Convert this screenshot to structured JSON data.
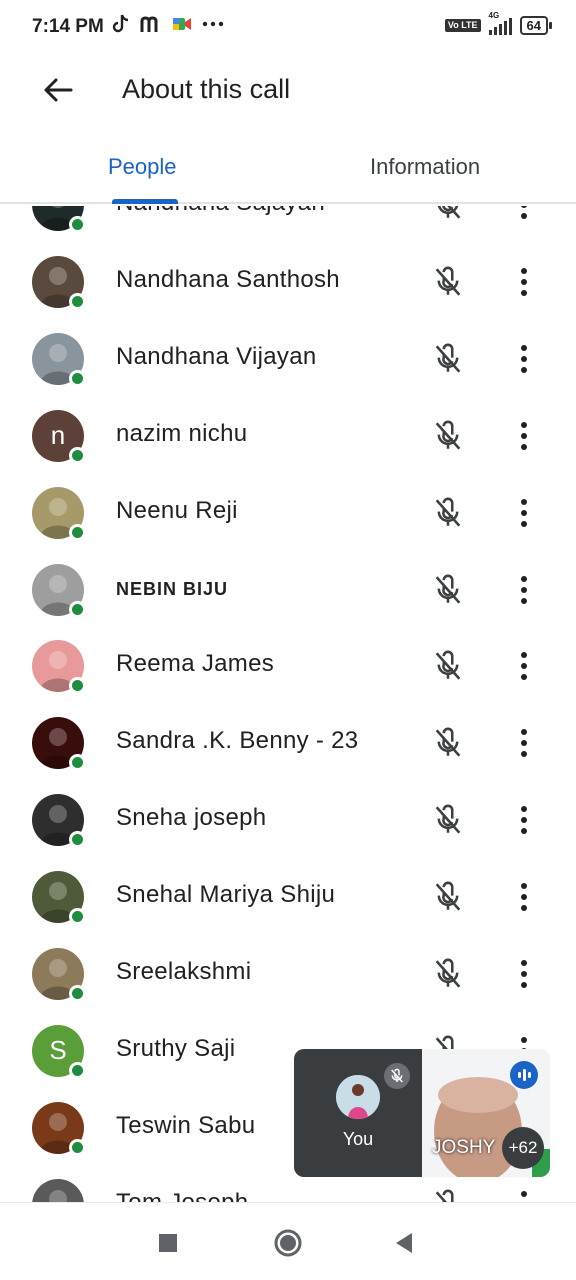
{
  "status_bar": {
    "time": "7:14 PM",
    "left_icons": [
      "tiktok-icon",
      "m-icon",
      "meet-icon",
      "more-notifications-icon"
    ],
    "network_label": "4G",
    "volte_label": "Vo LTE",
    "battery_level": "64"
  },
  "header": {
    "title": "About this call",
    "back_icon": "arrow-back-icon"
  },
  "tabs": [
    {
      "label": "People",
      "active": true
    },
    {
      "label": "Information",
      "active": false
    }
  ],
  "people": [
    {
      "name": "Nandhana Sajayan",
      "initial": "",
      "avatar_color": "#1f2a2a",
      "online": true,
      "muted": true,
      "partially_hidden": true
    },
    {
      "name": "Nandhana Santhosh",
      "initial": "",
      "avatar_color": "#5a4a3e",
      "online": true,
      "muted": true
    },
    {
      "name": "Nandhana Vijayan",
      "initial": "",
      "avatar_color": "#8a949c",
      "online": true,
      "muted": true
    },
    {
      "name": "nazim nichu",
      "initial": "n",
      "avatar_color": "#5d4037",
      "online": true,
      "muted": true
    },
    {
      "name": "Neenu Reji",
      "initial": "",
      "avatar_color": "#a69a6a",
      "online": true,
      "muted": true
    },
    {
      "name": "NEBIN BIJU",
      "initial": "",
      "avatar_color": "#9e9e9e",
      "online": true,
      "muted": true,
      "caps": true
    },
    {
      "name": "Reema James",
      "initial": "",
      "avatar_color": "#e89a9a",
      "online": true,
      "muted": true
    },
    {
      "name": "Sandra .K. Benny - 23",
      "initial": "",
      "avatar_color": "#3a0d0d",
      "online": true,
      "muted": true
    },
    {
      "name": "Sneha joseph",
      "initial": "",
      "avatar_color": "#2e2e2e",
      "online": true,
      "muted": true
    },
    {
      "name": "Snehal Mariya Shiju",
      "initial": "",
      "avatar_color": "#4f5a3a",
      "online": true,
      "muted": true
    },
    {
      "name": "Sreelakshmi",
      "initial": "",
      "avatar_color": "#8c7a5a",
      "online": true,
      "muted": true
    },
    {
      "name": "Sruthy Saji",
      "initial": "S",
      "avatar_color": "#5a9e3a",
      "online": true,
      "muted": true
    },
    {
      "name": "Teswin Sabu",
      "initial": "",
      "avatar_color": "#7a3a1a",
      "online": true,
      "muted": true
    },
    {
      "name": "Tom Joseph",
      "initial": "",
      "avatar_color": "#5a5a5a",
      "online": false,
      "muted": true,
      "partially_hidden": true
    }
  ],
  "pip": {
    "self_label": "You",
    "remote_name": "JOSHY",
    "more_count": "+62"
  },
  "colors": {
    "accent": "#1a63c7",
    "online": "#1e8e3e",
    "pip_background": "#3a3d40"
  }
}
